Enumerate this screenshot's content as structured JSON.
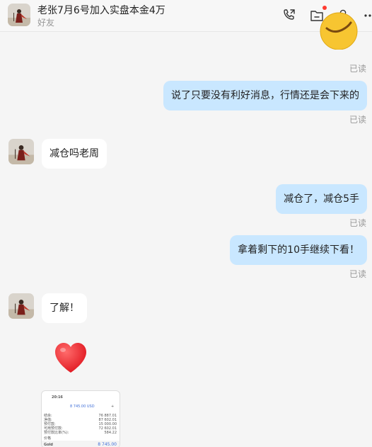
{
  "header": {
    "title": "老张7月6号加入实盘本金4万",
    "subtitle": "好友",
    "icons": [
      "phone-icon",
      "folder-icon",
      "add-user-icon",
      "more-icon"
    ],
    "notification_dot_color": "#ff3b30"
  },
  "messages": [
    {
      "type": "sticker",
      "sender": "self",
      "status": "已读"
    },
    {
      "type": "text",
      "sender": "self",
      "text": "说了只要没有利好消息，行情还是会下来的",
      "status": "已读"
    },
    {
      "type": "text",
      "sender": "friend",
      "text": "减仓吗老周"
    },
    {
      "type": "text",
      "sender": "self",
      "text": "减仓了，减仓5手",
      "status": "已读"
    },
    {
      "type": "text",
      "sender": "self",
      "text": "拿着剩下的10手继续下看！",
      "status": "已读"
    },
    {
      "type": "text",
      "sender": "friend",
      "text": "了解！"
    },
    {
      "type": "emoji",
      "sender": "friend",
      "icon": "red-heart-icon"
    },
    {
      "type": "image",
      "sender": "friend",
      "screenshot_texts": {
        "time": "20:16",
        "balance": "8 745.00 USD",
        "plus": "+",
        "rows": [
          {
            "label": "结余:",
            "value": "76 887.01"
          },
          {
            "label": "净值:",
            "value": "87 602.01"
          },
          {
            "label": "预付款:",
            "value": "15 000.00"
          },
          {
            "label": "可用预付款:",
            "value": "72 602.01"
          },
          {
            "label": "预付款比率(%):",
            "value": "584.22"
          }
        ],
        "section": "价格",
        "item_label": "Gold",
        "item_value": "8 745.00"
      }
    }
  ],
  "colors": {
    "sent_bubble": "#c9e7ff",
    "received_bubble": "#ffffff",
    "background": "#f5f5f5",
    "read_status": "#999999"
  }
}
